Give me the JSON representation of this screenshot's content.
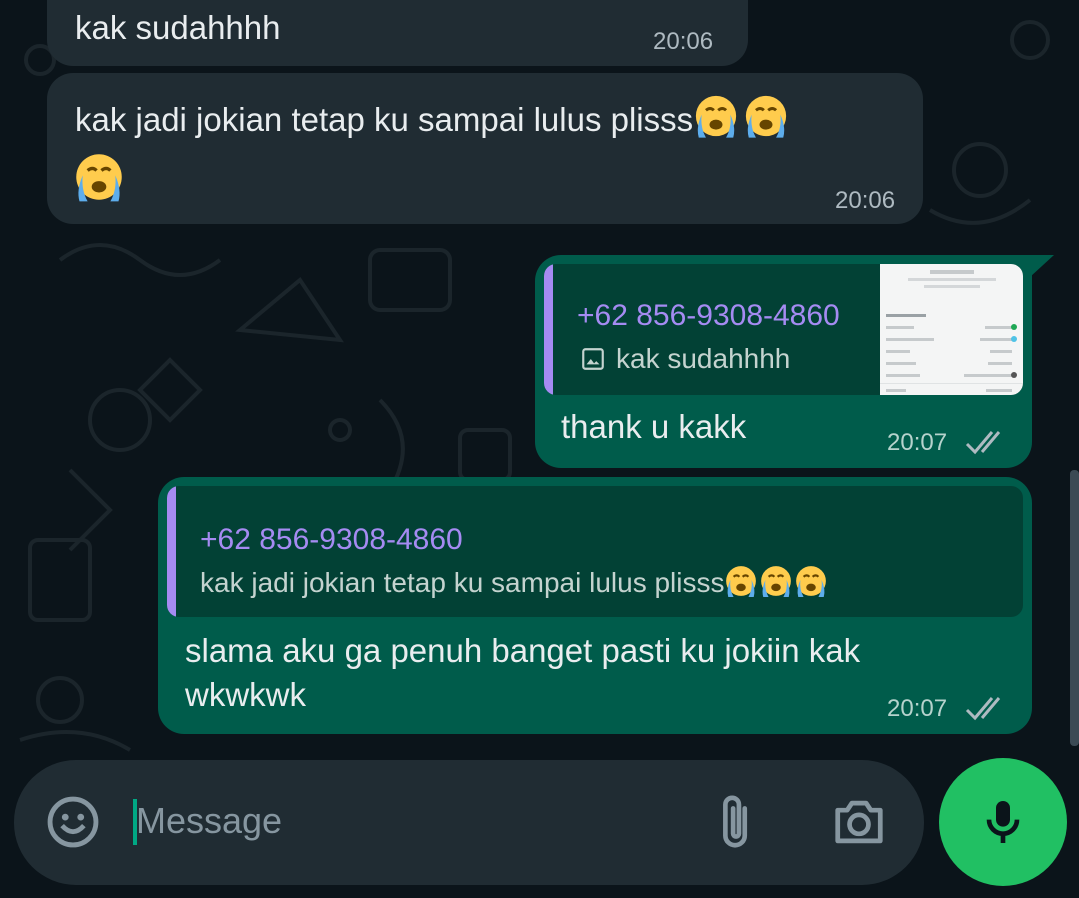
{
  "messages": [
    {
      "text": "kak sudahhhh",
      "time": "20:06"
    },
    {
      "text": "kak jadi jokian tetap ku sampai lulus plisss",
      "time": "20:06"
    },
    {
      "quote_sender": "+62 856-9308-4860",
      "quote_text": "kak sudahhhh",
      "text": "thank u kakk",
      "time": "20:07"
    },
    {
      "quote_sender": "+62 856-9308-4860",
      "quote_text": "kak jadi jokian tetap ku sampai lulus plisss",
      "text_line1": "slama aku ga penuh banget pasti ku jokiin kak",
      "text_line2": "wkwkwk",
      "time": "20:07"
    }
  ],
  "composer": {
    "placeholder": "Message"
  },
  "icons": {
    "emoji": "emoji-icon",
    "attach": "paperclip-icon",
    "camera": "camera-icon",
    "mic": "mic-icon",
    "image": "image-icon",
    "read": "double-check-icon",
    "crying": "loudly-crying-face"
  },
  "colors": {
    "background": "#0b141a",
    "incoming": "#202c33",
    "outgoing": "#005c4b",
    "quote_accent": "#a58bf2",
    "mic_button": "#21c063",
    "caret": "#00a884"
  }
}
